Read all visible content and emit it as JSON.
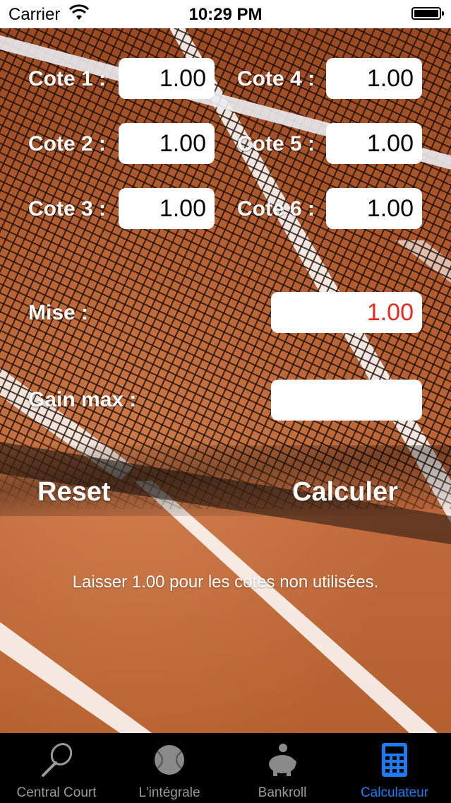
{
  "status_bar": {
    "carrier": "Carrier",
    "time": "10:29 PM"
  },
  "form": {
    "cotes": [
      {
        "label": "Cote 1 :",
        "value": "1.00"
      },
      {
        "label": "Cote 2 :",
        "value": "1.00"
      },
      {
        "label": "Cote 3 :",
        "value": "1.00"
      },
      {
        "label": "Cote 4 :",
        "value": "1.00"
      },
      {
        "label": "Cote 5 :",
        "value": "1.00"
      },
      {
        "label": "Cote 6 :",
        "value": "1.00"
      }
    ],
    "mise_label": "Mise :",
    "mise_value": "1.00",
    "gain_label": "Gain max :",
    "gain_value": "",
    "reset_label": "Reset",
    "calculer_label": "Calculer",
    "hint": "Laisser 1.00 pour les cotes non utilisées."
  },
  "tabs": [
    {
      "label": "Central Court",
      "icon": "racket-icon",
      "active": false
    },
    {
      "label": "L'intégrale",
      "icon": "tennis-ball-icon",
      "active": false
    },
    {
      "label": "Bankroll",
      "icon": "piggy-bank-icon",
      "active": false
    },
    {
      "label": "Calculateur",
      "icon": "calculator-icon",
      "active": true
    }
  ],
  "colors": {
    "accent": "#1b7cf3",
    "mise_value": "#e8281c",
    "tabbar_bg": "#000000"
  }
}
